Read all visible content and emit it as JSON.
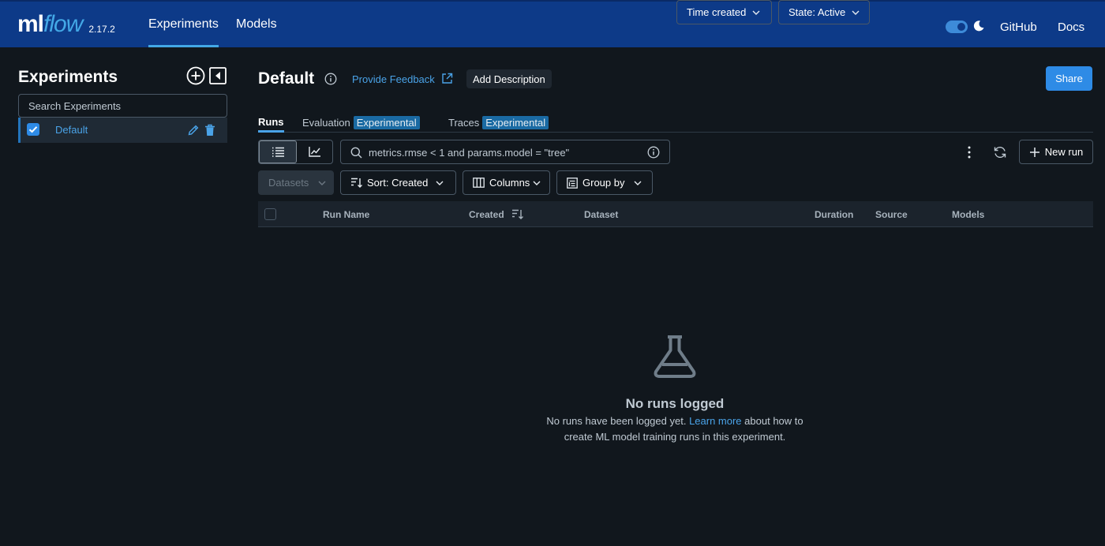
{
  "app": {
    "logo_ml": "ml",
    "logo_flow": "flow",
    "version": "2.17.2",
    "nav": [
      "Experiments",
      "Models"
    ],
    "links": [
      "GitHub",
      "Docs"
    ],
    "colors": {
      "header_bg": "#0d3a88",
      "accent": "#43a8e6",
      "primary_button": "#2e8be6"
    }
  },
  "sidebar": {
    "title": "Experiments",
    "search_placeholder": "Search Experiments",
    "items": [
      {
        "label": "Default",
        "checked": true
      }
    ]
  },
  "main": {
    "title": "Default",
    "feedback_label": "Provide Feedback",
    "add_description_label": "Add Description",
    "share_label": "Share",
    "tabs": [
      {
        "label": "Runs",
        "badge": ""
      },
      {
        "label": "Evaluation",
        "badge": "Experimental"
      },
      {
        "label": "Traces",
        "badge": "Experimental"
      }
    ],
    "search_text": "metrics.rmse < 1 and params.model = \"tree\"",
    "time_created_label": "Time created",
    "state_label": "State: Active",
    "new_run_label": "New run",
    "datasets_label": "Datasets",
    "sort_label": "Sort: Created",
    "columns_label": "Columns",
    "group_by_label": "Group by",
    "table_headers": [
      "Run Name",
      "Created",
      "Dataset",
      "Duration",
      "Source",
      "Models"
    ],
    "empty": {
      "title": "No runs logged",
      "text_before": "No runs have been logged yet.",
      "link": "Learn more",
      "text_after": "about how to create ML model training runs in this experiment."
    }
  }
}
